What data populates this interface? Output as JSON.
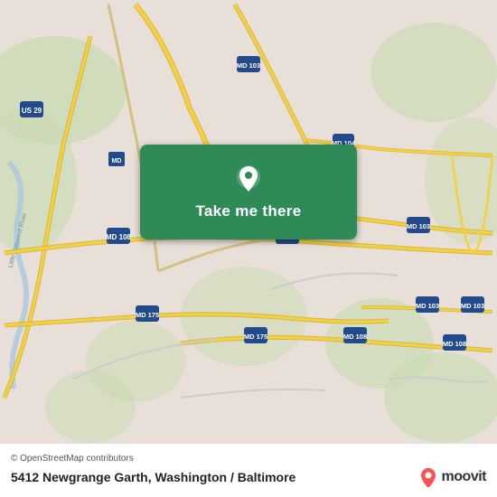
{
  "map": {
    "background_color": "#e8e0d8",
    "center_lat": 39.18,
    "center_lng": -76.83
  },
  "button": {
    "label": "Take me there",
    "bg_color": "#2e8b57",
    "icon": "location-pin"
  },
  "footer": {
    "osm_credit": "© OpenStreetMap contributors",
    "address": "5412 Newgrange Garth, Washington / Baltimore",
    "brand": "moovit"
  }
}
